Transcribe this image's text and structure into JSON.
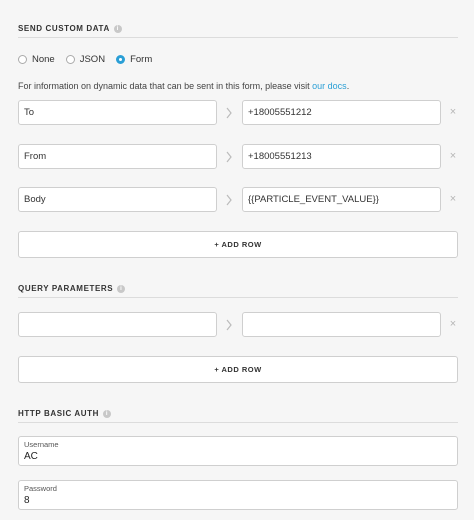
{
  "custom_data": {
    "title": "SEND CUSTOM DATA",
    "info_icon": "i",
    "options": [
      {
        "label": "None",
        "checked": false
      },
      {
        "label": "JSON",
        "checked": false
      },
      {
        "label": "Form",
        "checked": true
      }
    ],
    "info_prefix": "For information on dynamic data that can be sent in this form, please visit ",
    "info_link": "our docs",
    "info_suffix": ".",
    "rows": [
      {
        "key": "To",
        "value": "+18005551212"
      },
      {
        "key": "From",
        "value": "+18005551213"
      },
      {
        "key": "Body",
        "value": "{{PARTICLE_EVENT_VALUE}}"
      }
    ],
    "add_row_label": "+ ADD ROW",
    "remove_glyph": "×"
  },
  "query": {
    "title": "QUERY PARAMETERS",
    "info_icon": "i",
    "rows": [
      {
        "key": "",
        "value": ""
      }
    ],
    "add_row_label": "+ ADD ROW",
    "remove_glyph": "×"
  },
  "auth": {
    "title": "HTTP BASIC AUTH",
    "info_icon": "i",
    "username_label": "Username",
    "username_value": "AC",
    "password_label": "Password",
    "password_value": "8"
  },
  "colors": {
    "accent": "#2a9fd6",
    "background": "#f6f6f6",
    "border": "#cfcfcf"
  },
  "icons": {
    "separator": "chevron-right-icon",
    "remove": "close-icon",
    "info": "info-icon"
  }
}
